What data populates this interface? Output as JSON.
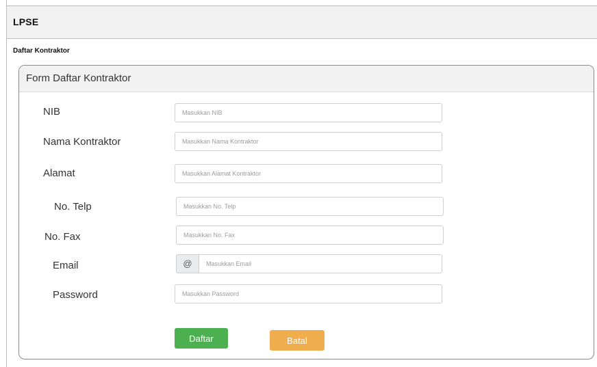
{
  "navbar": {
    "brand": "LPSE"
  },
  "breadcrumb": "Daftar Kontraktor",
  "form": {
    "title": "Form Daftar Kontraktor",
    "fields": {
      "nib": {
        "label": "NIB",
        "placeholder": "Masukkan NIB"
      },
      "nama": {
        "label": "Nama Kontraktor",
        "placeholder": "Masukkan Nama Kontraktor"
      },
      "alamat": {
        "label": "Alamat",
        "placeholder": "Masukkan Alamat Kontraktor"
      },
      "telp": {
        "label": "No. Telp",
        "placeholder": "Masukkan No. Telp"
      },
      "fax": {
        "label": "No. Fax",
        "placeholder": "Masukkan No. Fax"
      },
      "email": {
        "label": "Email",
        "placeholder": "Masukkan Email",
        "addon": "@"
      },
      "password": {
        "label": "Password",
        "placeholder": "Masukkan Password"
      }
    },
    "buttons": {
      "submit": "Daftar",
      "cancel": "Batal"
    }
  },
  "colors": {
    "submit": "#4caf50",
    "cancel": "#f0ad4e",
    "header_bg": "#f1f1f1"
  }
}
